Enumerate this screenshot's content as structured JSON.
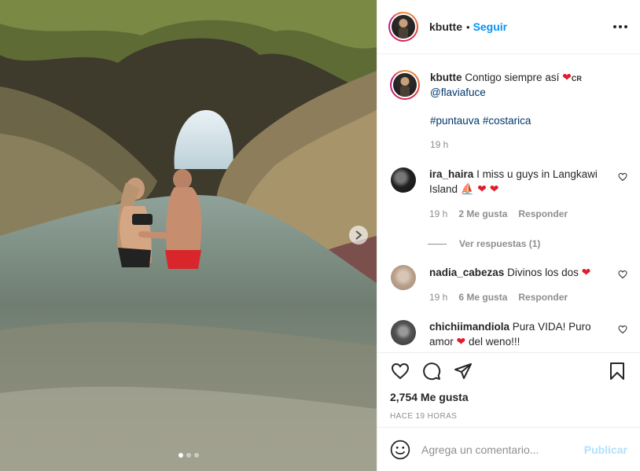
{
  "post": {
    "image_alt": "",
    "carousel_dots": 3,
    "active_dot": 0
  },
  "header": {
    "username": "kbutte",
    "separator": "•",
    "follow_label": "Seguir",
    "more_icon": "more-options-icon"
  },
  "caption": {
    "username": "kbutte",
    "text": "Contigo siempre así",
    "heart": "❤",
    "flag": "CR",
    "mention": "@flaviafuce",
    "tag1": "#puntauva",
    "tag2": "#costarica",
    "time": "19 h"
  },
  "comments": [
    {
      "username": "ira_haira",
      "text_before": "I miss u guys in Langkawi Island",
      "emoji_tail": "⛵ ❤ ❤",
      "time": "19 h",
      "likes": "2 Me gusta",
      "reply": "Responder",
      "view_replies": "Ver respuestas (1)"
    },
    {
      "username": "nadia_cabezas",
      "text_before": "Divinos los dos",
      "emoji_tail": "❤",
      "time": "19 h",
      "likes": "6 Me gusta",
      "reply": "Responder"
    },
    {
      "username": "chichiimandiola",
      "text_before": "Pura VIDA! Puro amor",
      "emoji_mid": "❤",
      "text_after": "del weno!!!"
    }
  ],
  "actions": {
    "like_count": "2,754 Me gusta",
    "time_ago": "HACE 19 HORAS"
  },
  "composer": {
    "placeholder": "Agrega un comentario...",
    "publish_label": "Publicar"
  },
  "colors": {
    "accent": "#0095f6",
    "link": "#00376b",
    "muted": "#8e8e8e",
    "heart": "#e01d2b",
    "publish_disabled": "#b2dffc"
  }
}
